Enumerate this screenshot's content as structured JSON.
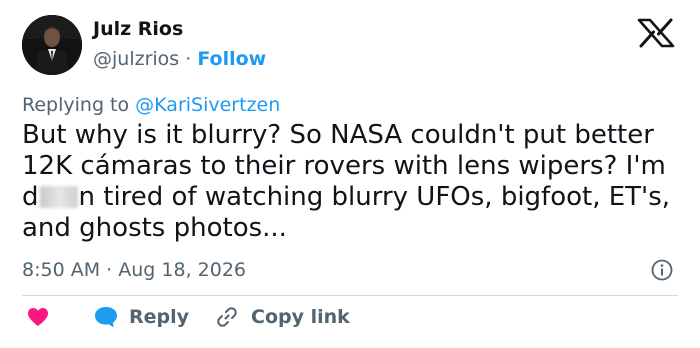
{
  "author": {
    "name": "Julz Rios",
    "handle": "@julzrios",
    "separator": "·",
    "follow_label": "Follow"
  },
  "reply_to": {
    "prefix": "Replying to",
    "mention": "@KariSivertzen"
  },
  "tweet": {
    "text_part1": "But why is it blurry? So NASA couldn't put better 12K cámaras to their rovers with lens wipers? I'm d",
    "text_part2": "n tired of watching blurry UFOs, bigfoot, ET's, and ghosts photos...",
    "time": "8:50 AM",
    "separator": "·",
    "date": "Aug 18, 2026"
  },
  "actions": {
    "reply_label": "Reply",
    "copy_link_label": "Copy link"
  },
  "icons": {
    "logo": "x-logo-icon",
    "info": "info-icon",
    "like": "heart-icon",
    "reply": "speech-bubble-icon",
    "copy": "link-icon"
  },
  "colors": {
    "accent": "#1d9bf0",
    "heart": "#f91880",
    "text": "#0f1419",
    "secondary": "#536471"
  }
}
